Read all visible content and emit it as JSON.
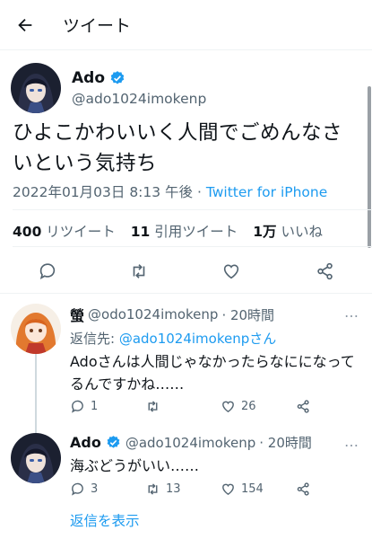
{
  "header": {
    "title": "ツイート"
  },
  "tweet": {
    "display_name": "Ado",
    "handle": "@ado1024imokenp",
    "text": "ひよこかわいいく人間でごめんなさいという気持ち",
    "timestamp": "2022年01月03日 8:13 午後",
    "separator": " · ",
    "source": "Twitter for iPhone",
    "retweets": "400",
    "retweets_label": "リツイート",
    "quotes": "11",
    "quotes_label": "引用ツイート",
    "likes": "1万",
    "likes_label": "いいね"
  },
  "replies": [
    {
      "display_name": "螢",
      "handle": "@odo1024imokenp",
      "time": "· 20時間",
      "replying_prefix": "返信先: ",
      "replying_to": "@ado1024imokenpさん",
      "text": "Adoさんは人間じゃなかったらなにになってるんですかね……",
      "reply_count": "1",
      "retweet_count": "",
      "like_count": "26",
      "more": "…"
    },
    {
      "display_name": "Ado",
      "handle": "@ado1024imokenp",
      "time": "· 20時間",
      "text": "海ぶどうがいい……",
      "reply_count": "3",
      "retweet_count": "13",
      "like_count": "154",
      "more": "…"
    }
  ],
  "show_replies": "返信を表示",
  "colors": {
    "accent": "#1d9bf0",
    "text": "#0f1419",
    "secondary": "#536471",
    "divider": "#eff3f4"
  },
  "icons": [
    "back-arrow-icon",
    "verified-badge-icon",
    "reply-icon",
    "retweet-icon",
    "like-icon",
    "share-icon",
    "more-icon"
  ]
}
